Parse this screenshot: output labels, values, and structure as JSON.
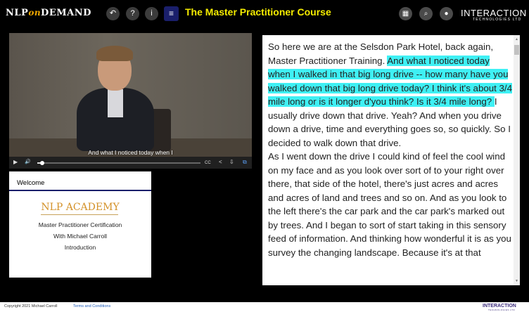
{
  "header": {
    "brand_prefix": "NLP",
    "brand_on": "on",
    "brand_suffix": "DEMAND",
    "course_title": "The Master Practitioner Course",
    "company_name": "INTERACTION",
    "company_sub": "TECHNOLOGIES LTD",
    "nav_icons": [
      "back-icon",
      "help-icon",
      "info-icon",
      "menu-icon"
    ],
    "right_icons": [
      "course-icon",
      "search-icon",
      "user-icon"
    ],
    "nav_glyphs": {
      "back": "↶",
      "help": "?",
      "info": "i",
      "menu": "≡",
      "course": "▦",
      "search": "⌕",
      "user": "●"
    }
  },
  "video": {
    "caption": "And what I noticed today when I",
    "progress": 0.03,
    "glyphs": {
      "play": "▶",
      "volume": "🔊",
      "cc": "CC",
      "share": "<",
      "download": "⇩",
      "pip": "⧉"
    }
  },
  "welcome": {
    "title": "Welcome",
    "logo_text": "NLP ACADEMY",
    "line1": "Master Practitioner Certification",
    "line2": "With Michael Carroll",
    "line3": "Introduction"
  },
  "transcript": {
    "before": "So here we are at the Selsdon Park Hotel, back again, Master Practitioner Training. ",
    "highlight": "And what I noticed today when I walked in that big long drive -- how many have you walked down that big long drive today? I think it's about 3/4 mile long or is it longer d'you think? Is it 3/4 mile long? ",
    "after": "I usually drive down that drive. Yeah? And when you drive down a drive, time and everything goes so, so quickly. So I decided to walk down that drive.",
    "paragraph2": "As I went down the drive I could kind of feel the cool wind on my face and as you look over sort of to your right over there, that side of the hotel, there's just acres and acres and acres of land and trees and so on. And as you look to the left there's the car park and the car park's marked out by trees. And I began to sort of start taking in this sensory feed of information. And thinking how wonderful it is as you survey the changing landscape. Because it's at that"
  },
  "footer": {
    "copyright": "Copyright 2021 Michael Carroll",
    "terms": "Terms and Conditions",
    "logo": "INTERACTION",
    "logo_sub": "TECHNOLOGIES LTD"
  },
  "colors": {
    "accent_yellow": "#f5ec00",
    "highlight_cyan": "#3ff0f4",
    "nav_blue": "#1a1f6b",
    "logo_gold": "#d4922a"
  }
}
